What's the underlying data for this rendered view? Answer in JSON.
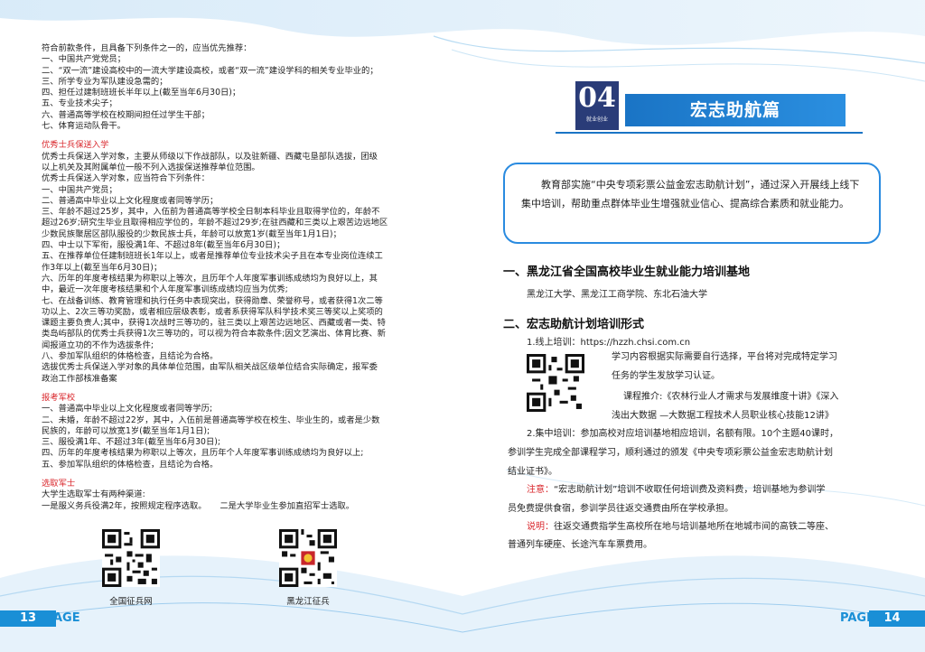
{
  "left": {
    "intro_lines": [
      "符合前款条件，且具备下列条件之一的，应当优先推荐：",
      "一、中国共产党党员；",
      "二、“双一流”建设高校中的一流大学建设高校，或者“双一流”建设学科的相关专业毕业的；",
      "三、所学专业为军队建设急需的；",
      "四、担任过建制班班长半年以上(截至当年6月30日)；",
      "五、专业技术尖子；",
      "六、普通高等学校在校期间担任过学生干部；",
      "七、体育运动队骨干。"
    ],
    "section1_title": "优秀士兵保送入学",
    "section1_lines": [
      "优秀士兵保送入学对象，主要从师级以下作战部队，以及驻新疆、西藏屯垦部队选拔，团级",
      "以上机关及其附属单位一般不列入选拔保送推荐单位范围。",
      "优秀士兵保送入学对象，应当符合下列条件：",
      "一、中国共产党员；",
      "二、普通高中毕业以上文化程度或者同等学历；",
      "三、年龄不超过25岁，其中，入伍前为普通高等学校全日制本科毕业且取得学位的，年龄不",
      "超过26岁;研究生毕业且取得相应学位的，年龄不超过29岁;在驻西藏和三类以上艰苦边远地区",
      "少数民族聚居区部队服役的少数民族士兵，年龄可以放宽1岁(截至当年1月1日)；",
      "四、中士以下军衔，服役满1年、不超过8年(截至当年6月30日)；",
      "五、在推荐单位任建制班班长1年以上，或者是推荐单位专业技术尖子且在本专业岗位连续工",
      "作3年以上(截至当年6月30日)；",
      "六、历年的年度考核结果为称职以上等次，且历年个人年度军事训练成绩均为良好以上，其",
      "中，最近一次年度考核结果和个人年度军事训练成绩均应当为优秀;",
      "七、在战备训练、教育管理和执行任务中表现突出，获得勋章、荣誉称号，或者获得1次二等",
      "功以上、2次三等功奖励，或者相应层级表彰，或者系获得军队科学技术奖三等奖以上奖项的",
      "课题主要负责人;其中，获得1次战时三等功的，驻三类以上艰苦边远地区、西藏或者一类、特",
      "类岛屿部队的优秀士兵获得1次三等功的，可以视为符合本款条件;因文艺演出、体育比赛、新",
      "闻报道立功的不作为选拔条件;",
      "八、参加军队组织的体格检查，且结论为合格。",
      "选拔优秀士兵保送入学对象的具体单位范围，由军队相关战区级单位结合实际确定，报军委",
      "政治工作部核准备案"
    ],
    "section2_title": "报考军校",
    "section2_lines": [
      "一、普通高中毕业以上文化程度或者同等学历;",
      "二、未婚，年龄不超过22岁，其中，入伍前是普通高等学校在校生、毕业生的，或者是少数",
      "民族的，年龄可以放宽1岁(截至当年1月1日);",
      "三、服役满1年、不超过3年(截至当年6月30日);",
      "四、历年的年度考核结果为称职以上等次，且历年个人年度军事训练成绩均为良好以上;",
      "五、参加军队组织的体格检查，且结论为合格。"
    ],
    "section3_title": "选取军士",
    "section3_lines": [
      "大学生选取军士有两种渠道:",
      "一是服义务兵役满2年，按照规定程序选取。     二是大学毕业生参加直招军士选取。"
    ],
    "qr1_caption": "全国征兵网",
    "qr2_caption": "黑龙江征兵"
  },
  "right": {
    "chapter_number": "04",
    "chapter_small": "就业创业",
    "chapter_title": "宏志助航篇",
    "intro_text": "教育部实施“中央专项彩票公益金宏志助航计划”，通过深入开展线上线下集中培训，帮助重点群体毕业生增强就业信心、提高综合素质和就业能力。",
    "h1": "一、黑龙江省全国高校毕业生就业能力培训基地",
    "h1_text": "黑龙江大学、黑龙江工商学院、东北石油大学",
    "h2": "二、宏志助航计划培训形式",
    "online_label": "1.线上培训：https://hzzh.chsi.com.cn",
    "online_line1": "学习内容根据实际需要自行选择，平台将对完成特定学习",
    "online_line2": "任务的学生发放学习认证。",
    "course_line1": "课程推介:《农林行业人才需求与发展维度十讲》《深入",
    "course_line2": "浅出大数据 —大数据工程技术人员职业核心技能12讲》",
    "offline_line1": "2.集中培训：参加高校对应培训基地相应培训，名额有限。10个主题40课时，",
    "offline_line2": "参训学生完成全部课程学习，顺利通过的颁发《中央专项彩票公益金宏志助航计划",
    "offline_line3": "结业证书》。",
    "note_label": "注意：",
    "note_line1": "“宏志助航计划”培训不收取任何培训费及资料费，培训基地为参训学",
    "note_line2": "员免费提供食宿，参训学员往返交通费由所在学校承担。",
    "explain_label": "说明：",
    "explain_line1": "往返交通费指学生高校所在地与培训基地所在地城市间的高铁二等座、",
    "explain_line2": "普通列车硬座、长途汽车车票费用。"
  },
  "footer": {
    "left_num": "13",
    "left_word": "PAGE",
    "right_word": "PAGE",
    "right_num": "14"
  },
  "colors": {
    "accent_blue": "#1a74c5",
    "badge_navy": "#2a3c78",
    "red": "#d9262b"
  }
}
